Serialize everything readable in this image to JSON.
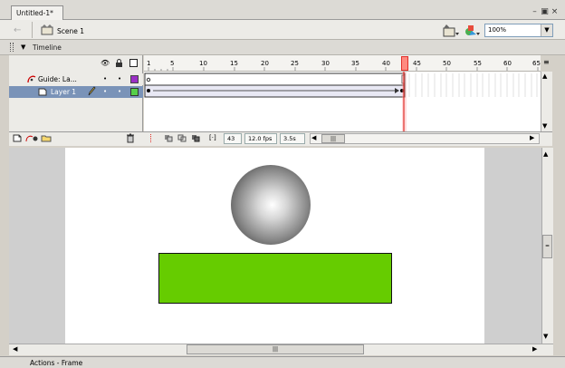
{
  "document": {
    "tab_title": "Untitled-1*"
  },
  "scene": {
    "label": "Scene 1",
    "zoom": "100%"
  },
  "timeline": {
    "title": "Timeline",
    "ruler_labels": [
      "1",
      "5",
      "10",
      "15",
      "20",
      "25",
      "30",
      "35",
      "40",
      "45",
      "50",
      "55",
      "60",
      "65"
    ],
    "layers": [
      {
        "name": "Guide: La...",
        "type": "guide",
        "color": "#9b30c6"
      },
      {
        "name": "Layer 1",
        "type": "normal",
        "color": "#56d04a"
      }
    ],
    "current_frame": "43",
    "fps": "12.0 fps",
    "time": "3.5s"
  },
  "stage": {
    "ball_gradient": [
      "#ffffff",
      "#2a2a2a"
    ],
    "rectangle_color": "#66cc00"
  },
  "bottom_panel": {
    "label": "Actions - Frame"
  }
}
